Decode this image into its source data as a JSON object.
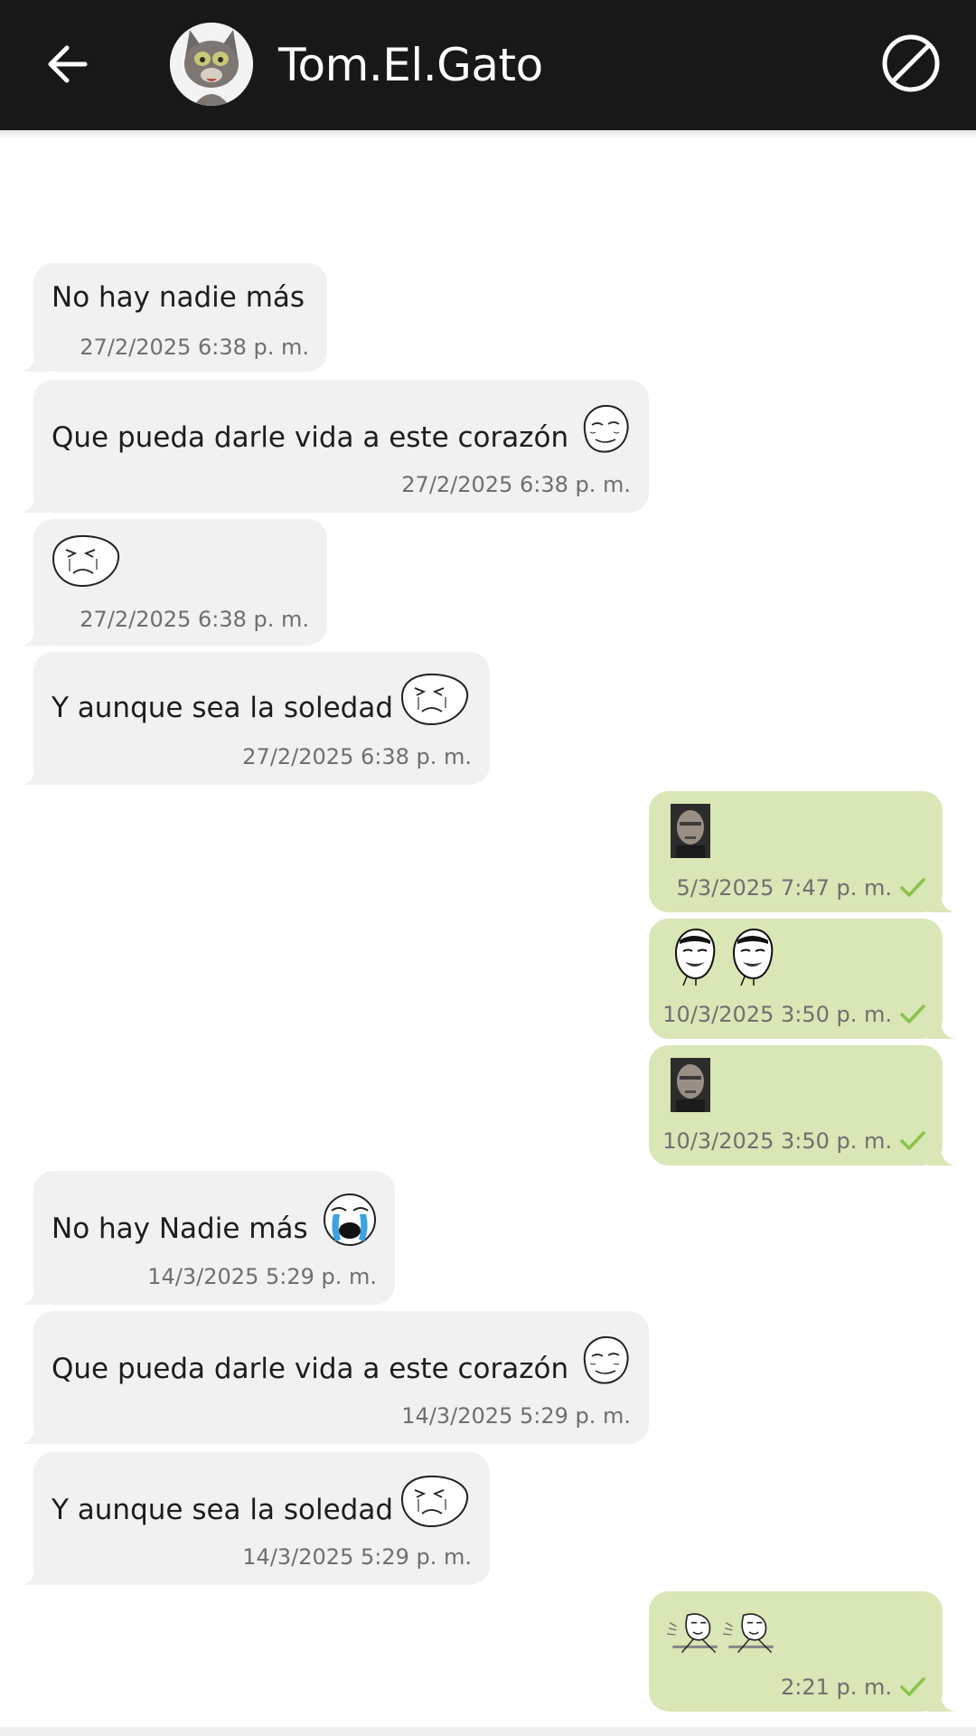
{
  "header": {
    "contact_name": "Tom.El.Gato",
    "back_icon": "arrow-left-icon",
    "block_icon": "block-icon",
    "background": "#181818"
  },
  "colors": {
    "incoming_bubble": "#f1f1f1",
    "outgoing_bubble": "#d9e6b6",
    "check": "#8bc34a"
  },
  "messages": [
    {
      "direction": "in",
      "text": "No hay nadie más",
      "sticker": "",
      "time": "27/2/2025 6:38 p. m."
    },
    {
      "direction": "in",
      "text": "Que pueda darle vida a este corazón",
      "sticker": "forever-alone-face",
      "time": "27/2/2025 6:38 p. m."
    },
    {
      "direction": "in",
      "text": "",
      "sticker": "sad-meme-face",
      "time": "27/2/2025 6:38 p. m."
    },
    {
      "direction": "in",
      "text": "Y aunque sea la soledad",
      "sticker": "sad-meme-face",
      "time": "27/2/2025 6:38 p. m."
    },
    {
      "direction": "out",
      "text": "",
      "sticker": "man-face",
      "time": "5/3/2025 7:47 p. m.",
      "status": "sent-check-icon"
    },
    {
      "direction": "out",
      "text": "",
      "sticker": "yao-ming-face x2",
      "time": "10/3/2025 3:50 p. m.",
      "status": "sent-check-icon"
    },
    {
      "direction": "out",
      "text": "",
      "sticker": "man-face",
      "time": "10/3/2025 3:50 p. m.",
      "status": "sent-check-icon"
    },
    {
      "direction": "in",
      "text": "No hay Nadie más",
      "sticker": "crying-face",
      "time": "14/3/2025 5:29 p. m."
    },
    {
      "direction": "in",
      "text": "Que pueda darle vida a este corazón",
      "sticker": "forever-alone-face",
      "time": "14/3/2025 5:29 p. m."
    },
    {
      "direction": "in",
      "text": "Y aunque sea la soledad",
      "sticker": "sad-meme-face",
      "time": "14/3/2025 5:29 p. m."
    },
    {
      "direction": "out",
      "text": "",
      "sticker": "spitting-meme x2",
      "time": "2:21 p. m.",
      "status": "sent-check-icon"
    }
  ]
}
